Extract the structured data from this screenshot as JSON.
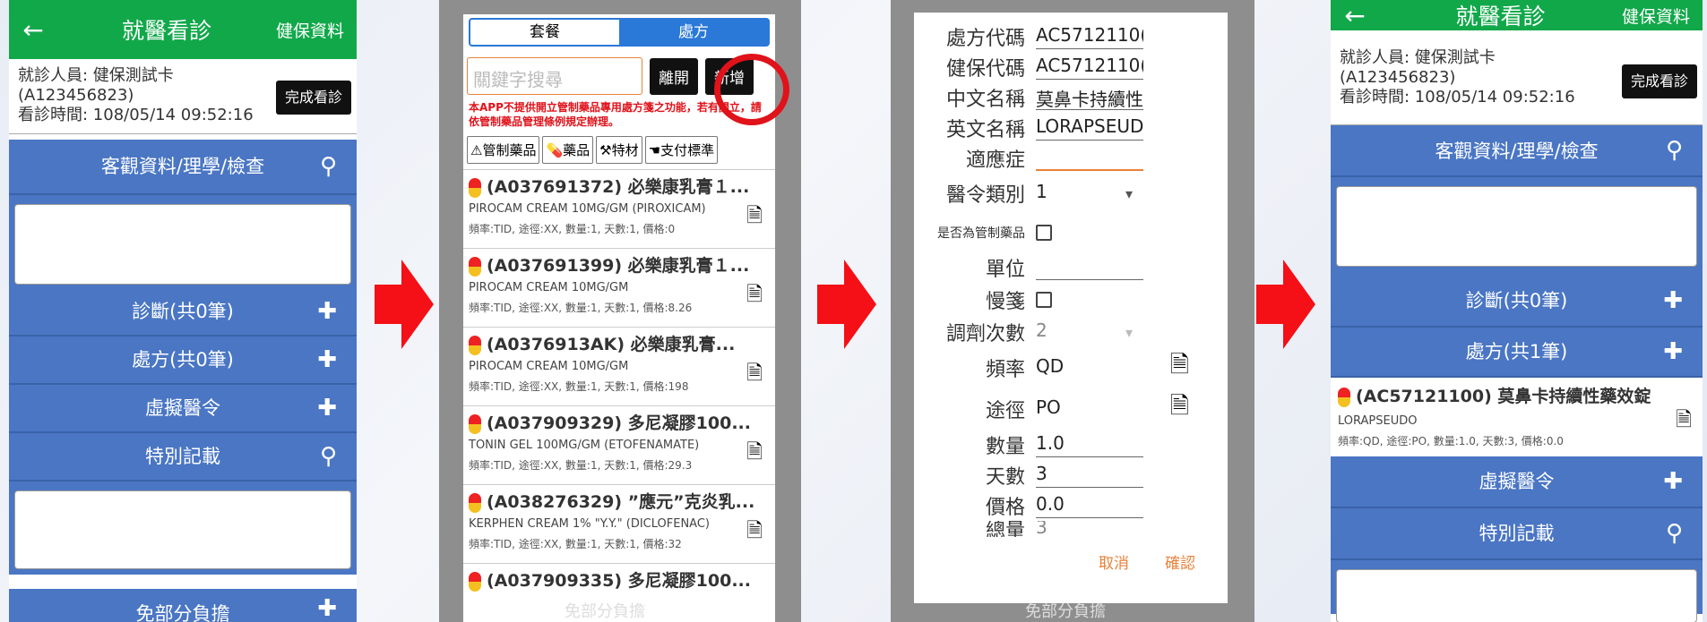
{
  "screen1": {
    "back": "←",
    "title": "就醫看診",
    "right": "健保資料",
    "patient_line1": "就診人員: 健保測試卡",
    "patient_line2": "(A123456823)",
    "patient_line3": "看診時間: 108/05/14 09:52:16",
    "done_button": "完成看診",
    "sections": {
      "objective": "客觀資料/理學/檢查",
      "diagnosis": "診斷(共0筆)",
      "prescription": "處方(共0筆)",
      "virtual": "虛擬醫令",
      "special": "特別記載",
      "copay": "免部分負擔"
    }
  },
  "screen2": {
    "tab_package": "套餐",
    "tab_prescription": "處方",
    "search_placeholder": "關鍵字搜尋",
    "leave_button": "離開",
    "add_button": "新增",
    "warning": "本APP不提供開立管制藥品專用處方箋之功能，若有開立，請依管制藥品管理條例規定辦理。",
    "chips": [
      "管制藥品",
      "藥品",
      "特材",
      "支付標準"
    ],
    "drugs": [
      {
        "title": "(A037691372) 必樂康乳膏１...",
        "en": "PIROCAM CREAM 10MG/GM (PIROXICAM)",
        "freq": "頻率:TID, 途徑:XX, 數量:1, 天數:1, 價格:0"
      },
      {
        "title": "(A037691399) 必樂康乳膏１...",
        "en": "PIROCAM CREAM 10MG/GM",
        "freq": "頻率:TID, 途徑:XX, 數量:1, 天數:1, 價格:8.26"
      },
      {
        "title": "(A0376913AK) 必樂康乳膏...",
        "en": "PIROCAM CREAM 10MG/GM",
        "freq": "頻率:TID, 途徑:XX, 數量:1, 天數:1, 價格:198"
      },
      {
        "title": "(A037909329) 多尼凝膠100...",
        "en": "TONIN GEL 100MG/GM (ETOFENAMATE)",
        "freq": "頻率:TID, 途徑:XX, 數量:1, 天數:1, 價格:29.3"
      },
      {
        "title": "(A038276329) ”應元”克炎乳...",
        "en": "KERPHEN CREAM 1% \"Y.Y.\" (DICLOFENAC)",
        "freq": "頻率:TID, 途徑:XX, 數量:1, 天數:1, 價格:32"
      },
      {
        "title": "(A037909335) 多尼凝膠100...",
        "en": "",
        "freq": ""
      }
    ],
    "bottom": "免部分負擔"
  },
  "screen3": {
    "rows": [
      {
        "label": "處方代碼",
        "value": "AC5712110("
      },
      {
        "label": "健保代碼",
        "value": "AC5712110("
      },
      {
        "label": "中文名稱",
        "value": "莫鼻卡持續性"
      },
      {
        "label": "英文名稱",
        "value": "LORAPSEUD"
      },
      {
        "label": "適應症",
        "value": ""
      },
      {
        "label": "醫令類別",
        "value": "1"
      },
      {
        "label": "是否為管制藥品",
        "value": ""
      },
      {
        "label": "單位",
        "value": ""
      },
      {
        "label": "慢箋",
        "value": ""
      },
      {
        "label": "調劑次數",
        "value": "2"
      },
      {
        "label": "頻率",
        "value": "QD"
      },
      {
        "label": "途徑",
        "value": "PO"
      },
      {
        "label": "數量",
        "value": "1.0"
      },
      {
        "label": "天數",
        "value": "3"
      },
      {
        "label": "價格",
        "value": "0.0"
      },
      {
        "label": "總量",
        "value": "3"
      }
    ],
    "cancel": "取消",
    "confirm": "確認",
    "bottom": "免部分負擔"
  },
  "screen4": {
    "back": "←",
    "title": "就醫看診",
    "right": "健保資料",
    "patient_line1": "就診人員: 健保測試卡",
    "patient_line2": "(A123456823)",
    "patient_line3": "看診時間: 108/05/14 09:52:16",
    "done_button": "完成看診",
    "sections": {
      "objective": "客觀資料/理學/檢查",
      "diagnosis": "診斷(共0筆)",
      "prescription": "處方(共1筆)",
      "virtual": "虛擬醫令",
      "special": "特別記載"
    },
    "drug": {
      "title": "(AC57121100) 莫鼻卡持續性藥效錠",
      "en": "LORAPSEUDO",
      "freq": "頻率:QD, 途徑:PO, 數量:1.0, 天數:3, 價格:0.0"
    }
  },
  "colors": {
    "green": "#11a84a",
    "blue": "#4a76c4",
    "red": "#e0121a",
    "orange": "#e8823a"
  }
}
